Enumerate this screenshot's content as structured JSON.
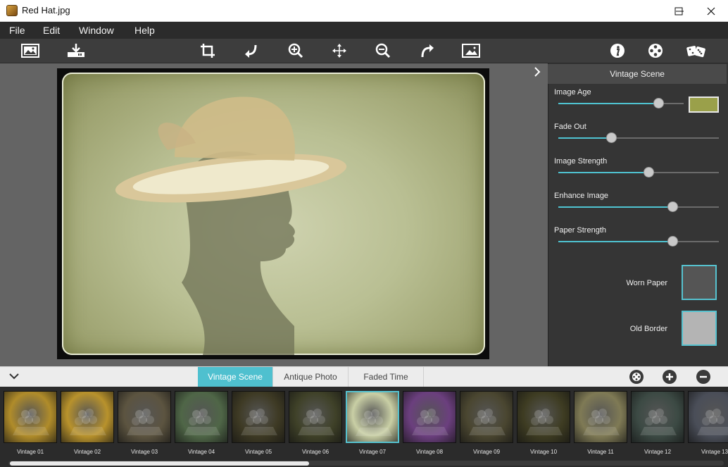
{
  "window": {
    "title": "Red Hat.jpg"
  },
  "menu": {
    "items": [
      "File",
      "Edit",
      "Window",
      "Help"
    ]
  },
  "panel": {
    "title": "Vintage Scene",
    "sliders": [
      {
        "label": "Image Age",
        "value": 0.8
      },
      {
        "label": "Fade Out",
        "value": 0.33
      },
      {
        "label": "Image Strength",
        "value": 0.56
      },
      {
        "label": "Enhance Image",
        "value": 0.71
      },
      {
        "label": "Paper Strength",
        "value": 0.71
      }
    ],
    "age_color": "#9aa04a",
    "textures": [
      {
        "label": "Worn Paper",
        "color": "#555555"
      },
      {
        "label": "Old Border",
        "color": "#b4b4b4"
      }
    ]
  },
  "tabs": [
    "Vintage Scene",
    "Antique Photo",
    "Faded Time"
  ],
  "active_tab": 0,
  "thumbnails": [
    {
      "label": "Vintage 01",
      "tone": "#b08c2a"
    },
    {
      "label": "Vintage 02",
      "tone": "#b8922c"
    },
    {
      "label": "Vintage 03",
      "tone": "#5c5440"
    },
    {
      "label": "Vintage 04",
      "tone": "#4f6647"
    },
    {
      "label": "Vintage 05",
      "tone": "#3e3a24"
    },
    {
      "label": "Vintage 06",
      "tone": "#3f4128"
    },
    {
      "label": "Vintage 07",
      "tone": "#c9cfa5"
    },
    {
      "label": "Vintage 08",
      "tone": "#6b3f7e"
    },
    {
      "label": "Vintage 09",
      "tone": "#4a4630"
    },
    {
      "label": "Vintage 10",
      "tone": "#3e3c22"
    },
    {
      "label": "Vintage 11",
      "tone": "#7f7a55"
    },
    {
      "label": "Vintage 12",
      "tone": "#3c4a44"
    },
    {
      "label": "Vintage 13",
      "tone": "#4a4e58"
    }
  ],
  "selected_thumbnail": 6,
  "accent_color": "#4fc3d1"
}
